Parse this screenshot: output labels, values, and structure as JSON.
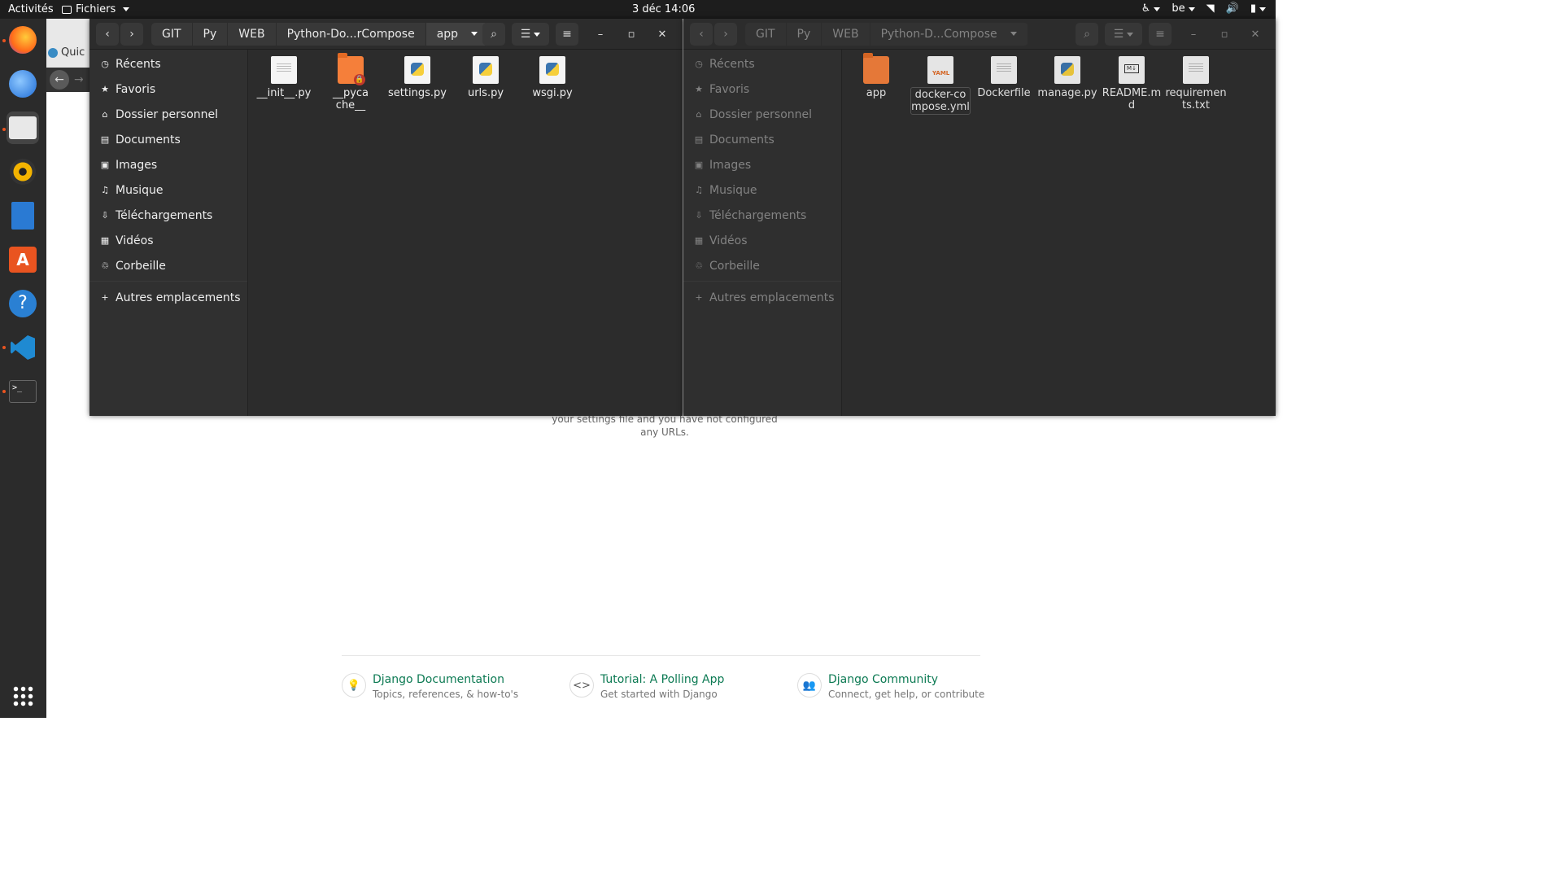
{
  "topbar": {
    "activities": "Activités",
    "app_menu": "Fichiers",
    "clock": "3 déc  14:06",
    "keyboard": "be"
  },
  "dock": {
    "items": [
      "firefox-icon",
      "thunderbird-icon",
      "files-icon",
      "rhythmbox-icon",
      "writer-icon",
      "software-icon",
      "help-icon",
      "vscode-icon",
      "terminal-icon"
    ],
    "show_apps": "show-apps-icon"
  },
  "browser": {
    "tab_label": "Quic",
    "django": {
      "text": "your settings file and you have not configured any URLs.",
      "links": [
        {
          "title": "Django Documentation",
          "sub": "Topics, references, & how-to's"
        },
        {
          "title": "Tutorial: A Polling App",
          "sub": "Get started with Django"
        },
        {
          "title": "Django Community",
          "sub": "Connect, get help, or contribute"
        }
      ]
    }
  },
  "left_window": {
    "path": [
      "GIT",
      "Py",
      "WEB",
      "Python-Do...rCompose",
      "app"
    ],
    "sidebar": [
      {
        "label": "Récents",
        "icon": "clock-icon"
      },
      {
        "label": "Favoris",
        "icon": "star-icon"
      },
      {
        "label": "Dossier personnel",
        "icon": "home-icon"
      },
      {
        "label": "Documents",
        "icon": "document-icon"
      },
      {
        "label": "Images",
        "icon": "image-icon"
      },
      {
        "label": "Musique",
        "icon": "music-icon"
      },
      {
        "label": "Téléchargements",
        "icon": "download-icon"
      },
      {
        "label": "Vidéos",
        "icon": "video-icon"
      },
      {
        "label": "Corbeille",
        "icon": "trash-icon"
      }
    ],
    "other_places": "Autres emplacements",
    "files": [
      {
        "name": "__init__.py",
        "type": "text"
      },
      {
        "name": "__pycache__",
        "type": "folder-locked"
      },
      {
        "name": "settings.py",
        "type": "python"
      },
      {
        "name": "urls.py",
        "type": "python"
      },
      {
        "name": "wsgi.py",
        "type": "python"
      }
    ]
  },
  "right_window": {
    "path": [
      "GIT",
      "Py",
      "WEB",
      "Python-D...Compose"
    ],
    "sidebar": [
      {
        "label": "Récents",
        "icon": "clock-icon"
      },
      {
        "label": "Favoris",
        "icon": "star-icon"
      },
      {
        "label": "Dossier personnel",
        "icon": "home-icon"
      },
      {
        "label": "Documents",
        "icon": "document-icon"
      },
      {
        "label": "Images",
        "icon": "image-icon"
      },
      {
        "label": "Musique",
        "icon": "music-icon"
      },
      {
        "label": "Téléchargements",
        "icon": "download-icon"
      },
      {
        "label": "Vidéos",
        "icon": "video-icon"
      },
      {
        "label": "Corbeille",
        "icon": "trash-icon"
      }
    ],
    "other_places": "Autres emplacements",
    "files": [
      {
        "name": "app",
        "type": "folder"
      },
      {
        "name": "docker-compose.yml",
        "type": "yaml",
        "badge": "YAML"
      },
      {
        "name": "Dockerfile",
        "type": "text"
      },
      {
        "name": "manage.py",
        "type": "python"
      },
      {
        "name": "README.md",
        "type": "markdown",
        "badge": "M↓"
      },
      {
        "name": "requirements.txt",
        "type": "text"
      }
    ]
  }
}
